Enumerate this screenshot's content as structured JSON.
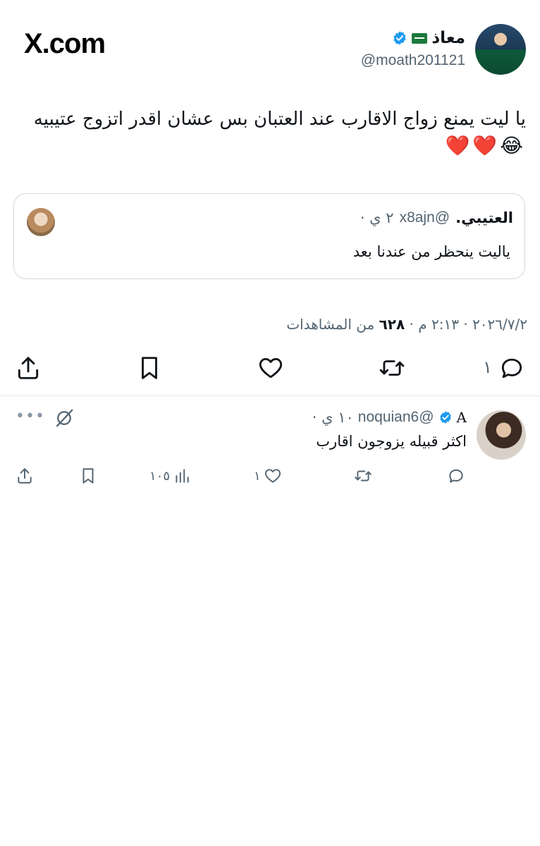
{
  "header": {
    "site_logo": "X.com",
    "author_name": "معاذ",
    "author_flag": "saudi-flag",
    "author_handle": "@moath201121"
  },
  "tweet": {
    "text": "يا ليت يمنع زواج الاقارب عند العتبان بس عشان اقدر اتزوج عتيبيه",
    "emojis": "😂❤️❤️"
  },
  "quote": {
    "name": "العتيبي.",
    "handle": "@x8ajn",
    "time": "٢ ي ·",
    "text": "ياليت ينحظر من عندنا بعد"
  },
  "meta": {
    "date": "٢٠٢٦/٧/٢",
    "time": "٢:١٣ م",
    "views": "٦٢٨",
    "views_label": "من المشاهدات"
  },
  "actions": {
    "reply_count": "١",
    "accent": "#0f1419"
  },
  "reply": {
    "name": "A",
    "handle": "@noquian6",
    "time": "١٠ ي ·",
    "text": "اكثر قبيله يزوجون اقارب",
    "views": "١٠٥",
    "likes": "١",
    "more": "•••"
  },
  "colors": {
    "verified": "#1d9bf0",
    "secondary_text": "#536471",
    "border": "#cfd9de"
  }
}
